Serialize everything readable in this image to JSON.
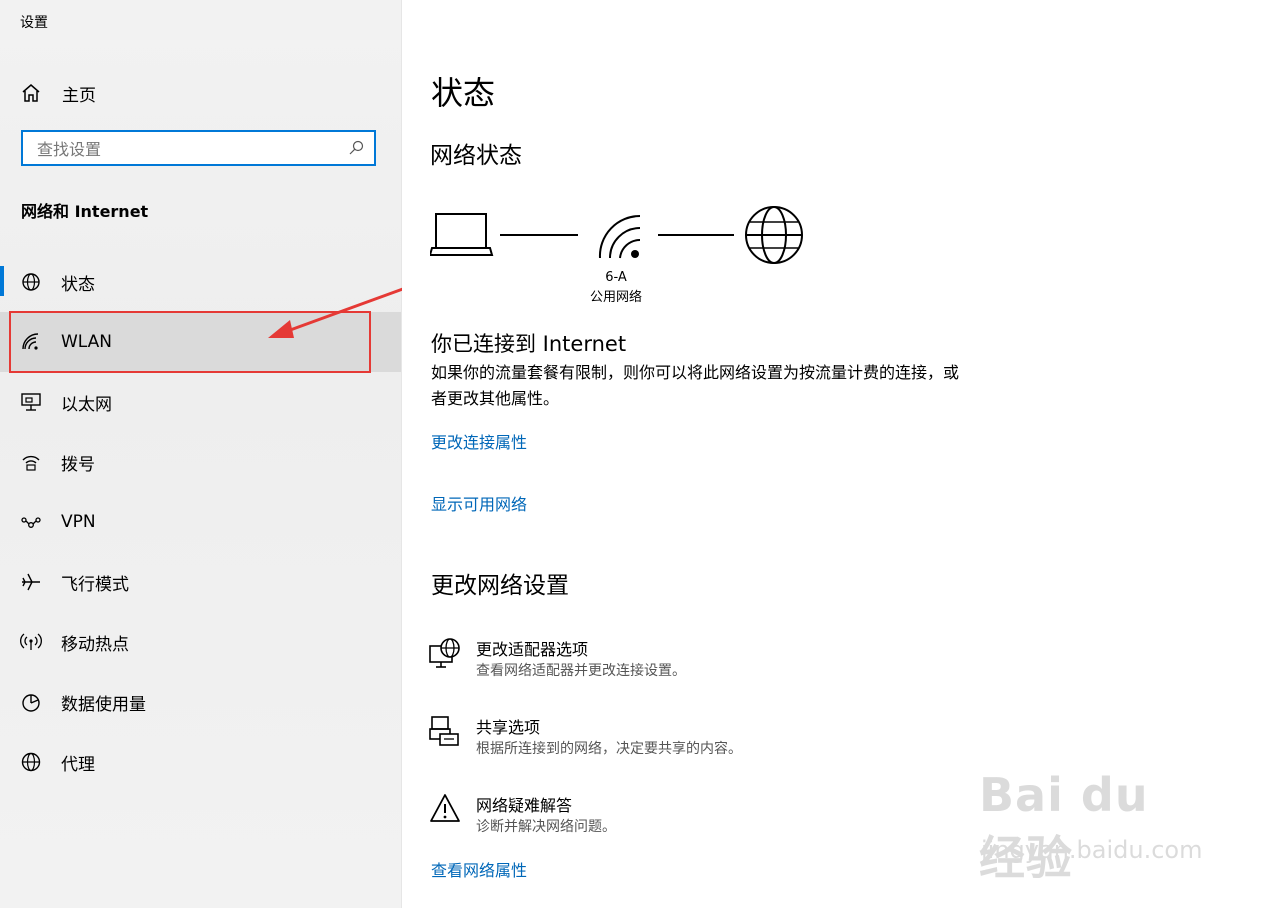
{
  "window": {
    "title": "设置"
  },
  "sidebar": {
    "home_label": "主页",
    "search_placeholder": "查找设置",
    "section_title": "网络和 Internet",
    "items": [
      {
        "label": "状态",
        "icon": "globe-status-icon"
      },
      {
        "label": "WLAN",
        "icon": "wifi-icon"
      },
      {
        "label": "以太网",
        "icon": "ethernet-icon"
      },
      {
        "label": "拨号",
        "icon": "dialup-icon"
      },
      {
        "label": "VPN",
        "icon": "vpn-icon"
      },
      {
        "label": "飞行模式",
        "icon": "airplane-icon"
      },
      {
        "label": "移动热点",
        "icon": "hotspot-icon"
      },
      {
        "label": "数据使用量",
        "icon": "data-usage-icon"
      },
      {
        "label": "代理",
        "icon": "globe-icon"
      }
    ],
    "active_index": 0,
    "highlighted_index": 1
  },
  "main": {
    "page_title": "状态",
    "network_status_title": "网络状态",
    "network": {
      "ssid": "6-A",
      "type": "公用网络"
    },
    "connected_title": "你已连接到 Internet",
    "connected_desc": "如果你的流量套餐有限制，则你可以将此网络设置为按流量计费的连接，或者更改其他属性。",
    "link_change_properties": "更改连接属性",
    "link_show_networks": "显示可用网络",
    "change_settings_title": "更改网络设置",
    "options": [
      {
        "title": "更改适配器选项",
        "desc": "查看网络适配器并更改连接设置。",
        "icon": "adapter-icon"
      },
      {
        "title": "共享选项",
        "desc": "根据所连接到的网络，决定要共享的内容。",
        "icon": "sharing-icon"
      },
      {
        "title": "网络疑难解答",
        "desc": "诊断并解决网络问题。",
        "icon": "warning-icon"
      }
    ],
    "link_view_properties": "查看网络属性"
  },
  "watermark": {
    "brand": "Bai du 经验",
    "url": "jingyan.baidu.com"
  },
  "colors": {
    "accent": "#0078d7",
    "link": "#0067b8",
    "annotation": "#e53935"
  }
}
